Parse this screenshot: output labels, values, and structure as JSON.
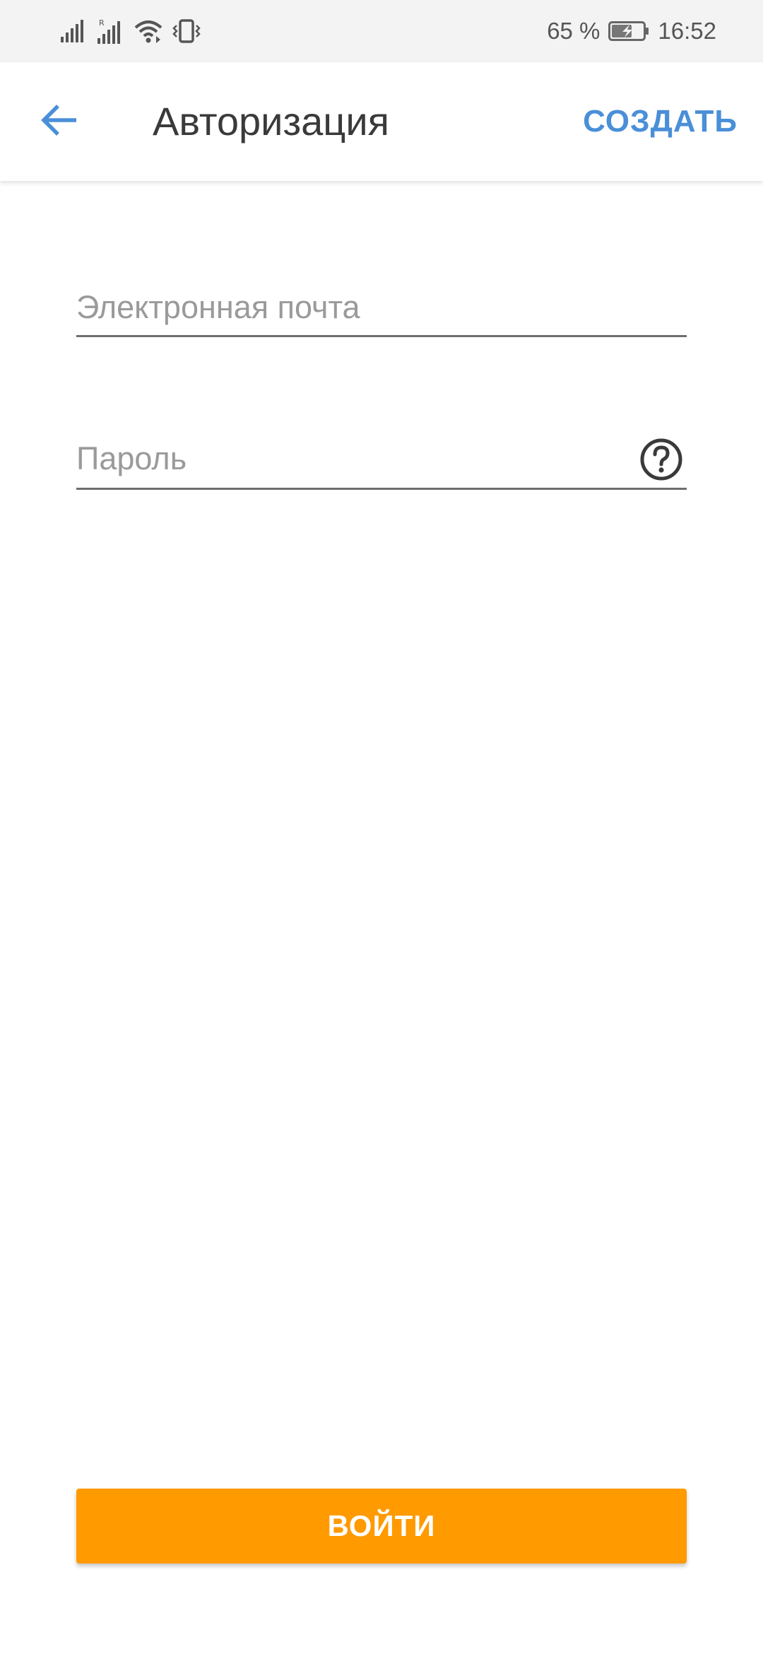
{
  "status_bar": {
    "battery_percent": "65 %",
    "battery_level": 0.65,
    "time": "16:52",
    "icons": [
      "cellular-signal-icon",
      "cellular-signal-roaming-icon",
      "wifi-icon",
      "vibrate-icon",
      "battery-charging-icon"
    ]
  },
  "app_bar": {
    "back_icon": "arrow-back-icon",
    "title": "Авторизация",
    "create_label": "СОЗДАТЬ"
  },
  "form": {
    "email": {
      "value": "",
      "placeholder": "Электронная почта"
    },
    "password": {
      "value": "",
      "placeholder": "Пароль",
      "help_icon": "help-circle-icon"
    }
  },
  "login_button": {
    "label": "ВОЙТИ"
  },
  "colors": {
    "accent_blue": "#4a8fd8",
    "button_orange": "#ff9a00",
    "status_bar_bg": "#f3f3f3",
    "underline": "#6e6e6e"
  }
}
